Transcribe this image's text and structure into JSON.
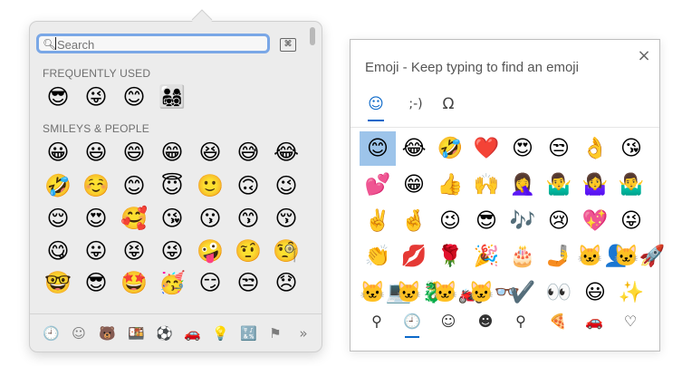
{
  "mac": {
    "search_placeholder": "Search",
    "sections": {
      "frequent": "FREQUENTLY USED",
      "smileys": "SMILEYS & PEOPLE"
    },
    "frequent": [
      "😎",
      "😜",
      "😊",
      "👨‍👩‍👧‍👦"
    ],
    "rows": [
      [
        "😀",
        "😃",
        "😄",
        "😁",
        "😆",
        "😅",
        "😂"
      ],
      [
        "🤣",
        "☺️",
        "😊",
        "😇",
        "🙂",
        "🙃",
        "😉"
      ],
      [
        "😌",
        "😍",
        "🥰",
        "😘",
        "😗",
        "😙",
        "😚"
      ],
      [
        "😋",
        "😛",
        "😝",
        "😜",
        "🤪",
        "🤨",
        "🧐"
      ],
      [
        "🤓",
        "😎",
        "🤩",
        "🥳",
        "😏",
        "😒",
        "😞"
      ]
    ],
    "categories": [
      {
        "icon": "🕘",
        "name": "recent"
      },
      {
        "icon": "☺",
        "name": "smileys"
      },
      {
        "icon": "🐻",
        "name": "animals"
      },
      {
        "icon": "🍱",
        "name": "food"
      },
      {
        "icon": "⚽",
        "name": "activity"
      },
      {
        "icon": "🚗",
        "name": "travel"
      },
      {
        "icon": "💡",
        "name": "objects"
      },
      {
        "icon": "🔣",
        "name": "symbols"
      },
      {
        "icon": "⚑",
        "name": "flags"
      },
      {
        "icon": "»",
        "name": "more"
      }
    ]
  },
  "win": {
    "title": "Emoji - Keep typing to find an emoji",
    "close": "×",
    "tabs": [
      {
        "icon": "☺",
        "name": "emoji"
      },
      {
        "icon": ";-)",
        "name": "kaomoji"
      },
      {
        "icon": "Ω",
        "name": "symbols"
      }
    ],
    "rows": [
      [
        "😊",
        "😂",
        "🤣",
        "❤️",
        "😍",
        "😒",
        "👌",
        "😘"
      ],
      [
        "💕",
        "😁",
        "👍",
        "🙌",
        "🤦‍♀️",
        "🤷‍♂️",
        "🤷‍♀️",
        "🤷‍♂️"
      ],
      [
        "✌️",
        "🤞",
        "😉",
        "😎",
        "🎶",
        "😢",
        "💖",
        "😜"
      ],
      [
        "👏",
        "💋",
        "🌹",
        "🎉",
        "🎂",
        "🤳",
        "🐱‍👤",
        "🐱‍🚀"
      ],
      [
        "🐱‍💻",
        "🐱‍🐉",
        "🐱‍🏍",
        "🐱‍👓",
        "✔️",
        "👀",
        "😃",
        "✨"
      ]
    ],
    "categories": [
      {
        "icon": "⚲",
        "name": "search"
      },
      {
        "icon": "🕘",
        "name": "recent"
      },
      {
        "icon": "☺",
        "name": "smileys"
      },
      {
        "icon": "☻",
        "name": "people"
      },
      {
        "icon": "⚲",
        "name": "places"
      },
      {
        "icon": "🍕",
        "name": "food"
      },
      {
        "icon": "🚗",
        "name": "transport"
      },
      {
        "icon": "♡",
        "name": "symbols"
      }
    ]
  }
}
